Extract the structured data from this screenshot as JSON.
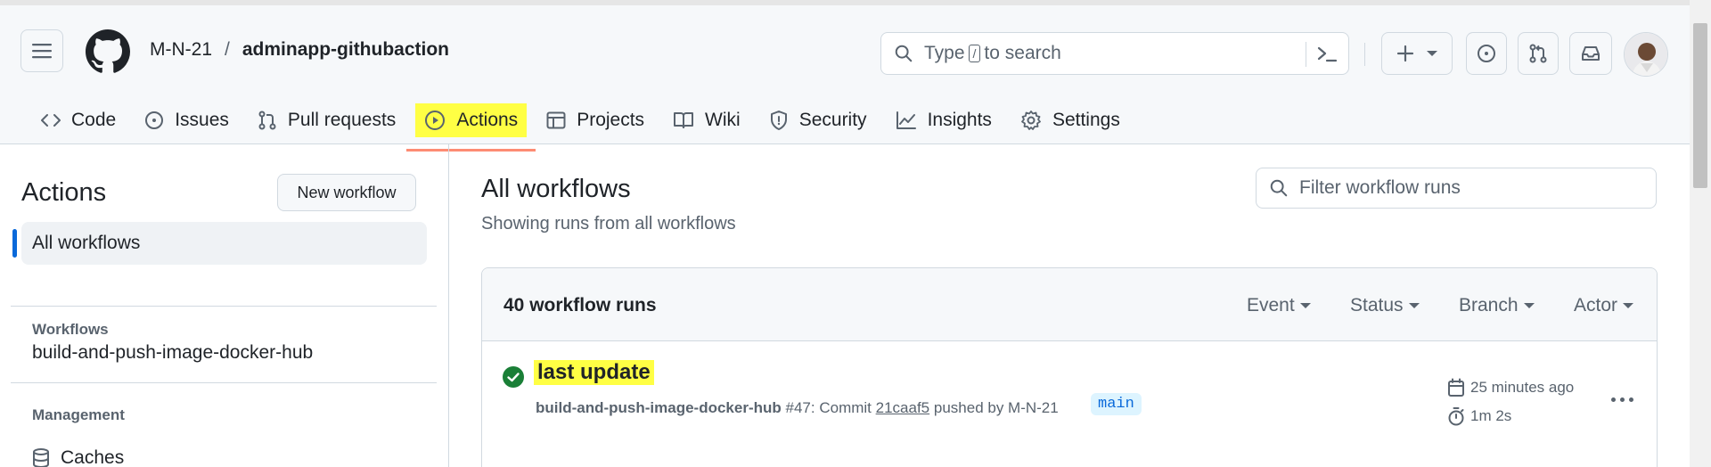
{
  "header": {
    "owner": "M-N-21",
    "separator": "/",
    "repo": "adminapp-githubaction",
    "search": {
      "prefix": "Type",
      "key": "/",
      "suffix": "to search"
    }
  },
  "tabs": [
    {
      "label": "Code",
      "icon": "code-icon"
    },
    {
      "label": "Issues",
      "icon": "issue-icon"
    },
    {
      "label": "Pull requests",
      "icon": "pull-request-icon"
    },
    {
      "label": "Actions",
      "icon": "play-icon",
      "active": true
    },
    {
      "label": "Projects",
      "icon": "table-icon"
    },
    {
      "label": "Wiki",
      "icon": "book-icon"
    },
    {
      "label": "Security",
      "icon": "shield-icon"
    },
    {
      "label": "Insights",
      "icon": "graph-icon"
    },
    {
      "label": "Settings",
      "icon": "gear-icon"
    }
  ],
  "sidebar": {
    "title": "Actions",
    "new_workflow": "New workflow",
    "all_workflows": "All workflows",
    "workflows_heading": "Workflows",
    "workflow_item": "build-and-push-image-docker-hub",
    "management_heading": "Management",
    "caches": "Caches"
  },
  "main": {
    "title": "All workflows",
    "subtitle": "Showing runs from all workflows",
    "filter_placeholder": "Filter workflow runs",
    "runs_count": "40 workflow runs",
    "filters": [
      "Event",
      "Status",
      "Branch",
      "Actor"
    ]
  },
  "run": {
    "title": "last update",
    "workflow": "build-and-push-image-docker-hub",
    "number": "#47",
    "commit_label": "Commit",
    "sha": "21caaf5",
    "pushed_by": "pushed by M-N-21",
    "branch": "main",
    "time_ago": "25 minutes ago",
    "duration": "1m 2s",
    "status": "success"
  },
  "colors": {
    "highlight": "#ffff44",
    "success": "#1a7f37",
    "accent": "#0969da",
    "underline": "#fd8c73"
  }
}
